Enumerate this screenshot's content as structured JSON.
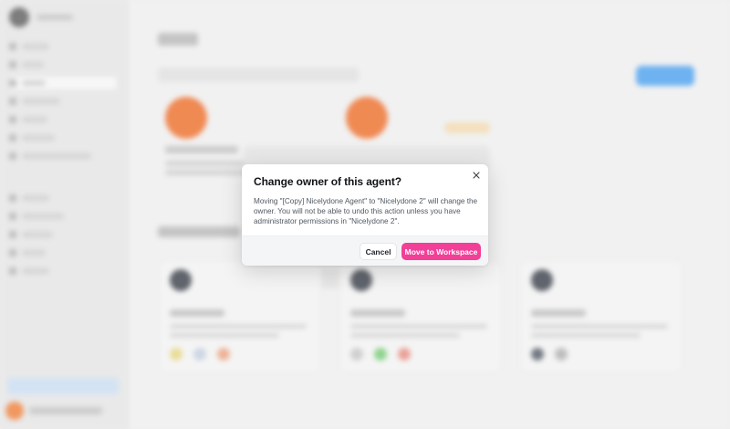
{
  "dialog": {
    "title": "Change owner of this agent?",
    "message": "Moving \"[Copy] Nicelydone Agent\" to \"Nicelydone 2\" will change the owner. You will not be able to undo this action unless you have administrator permissions in \"Nicelydone 2\".",
    "cancel_label": "Cancel",
    "confirm_label": "Move to Workspace",
    "close_icon": "close-icon"
  },
  "colors": {
    "accent": "#f23f98",
    "background_primary_button": "#5aa8ef",
    "agent_avatar": "#ee7a3c"
  }
}
